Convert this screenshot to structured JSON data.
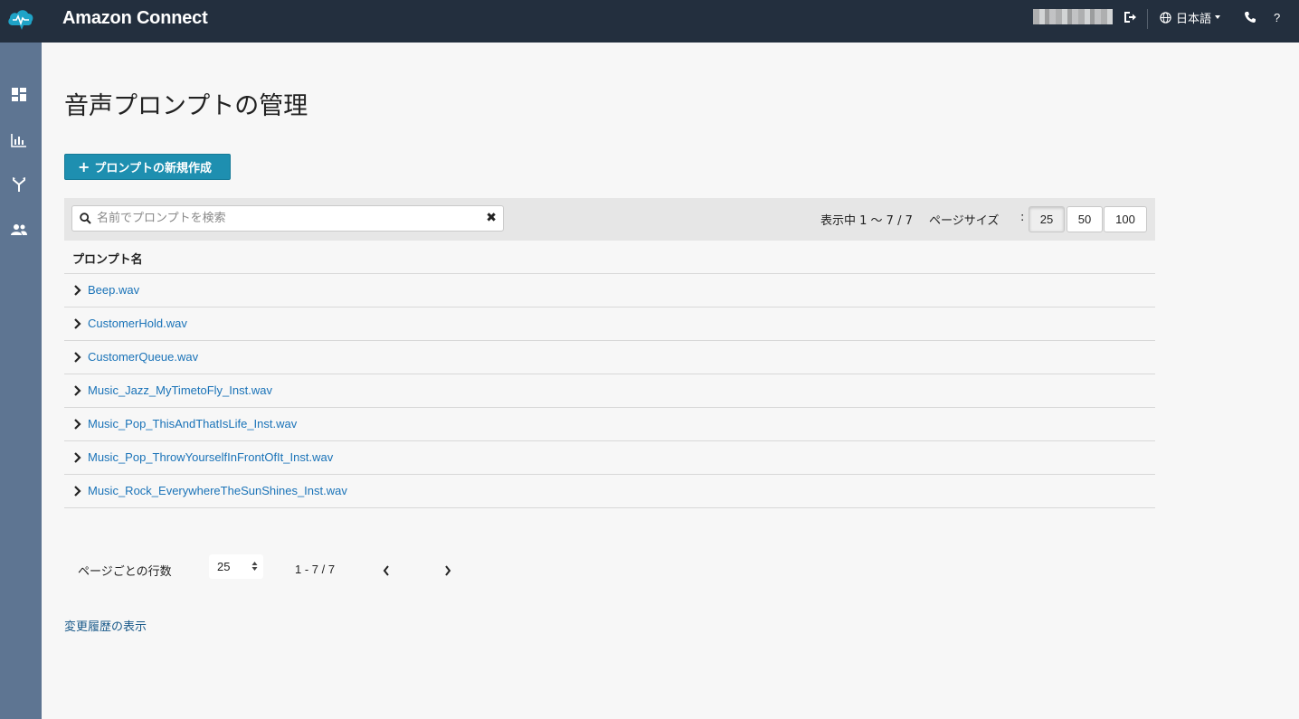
{
  "header": {
    "app_title": "Amazon Connect",
    "language": "日本語",
    "help": "?",
    "icons": [
      "cloud-logo-icon",
      "logout-icon",
      "globe-icon",
      "phone-icon",
      "help-icon"
    ]
  },
  "sidebar": {
    "items": [
      {
        "icon": "dashboard-icon"
      },
      {
        "icon": "bar-chart-icon"
      },
      {
        "icon": "routing-icon"
      },
      {
        "icon": "users-icon"
      }
    ]
  },
  "page": {
    "title": "音声プロンプトの管理",
    "create_button": "プロンプトの新規作成"
  },
  "toolbar": {
    "search_placeholder": "名前でプロンプトを検索",
    "showing": "表示中 1 〜 7 / 7",
    "page_size_label": "ページサイズ",
    "colon": ":",
    "page_sizes": [
      "25",
      "50",
      "100"
    ],
    "active_page_size": "25"
  },
  "table": {
    "column_header": "プロンプト名",
    "rows": [
      "Beep.wav",
      "CustomerHold.wav",
      "CustomerQueue.wav",
      "Music_Jazz_MyTimetoFly_Inst.wav",
      "Music_Pop_ThisAndThatIsLife_Inst.wav",
      "Music_Pop_ThrowYourselfInFrontOfIt_Inst.wav",
      "Music_Rock_EverywhereTheSunShines_Inst.wav"
    ]
  },
  "footer": {
    "rows_per_page_label": "ページごとの行数",
    "rows_per_page_value": "25",
    "range": "1 - 7 / 7",
    "history_link": "変更履歴の表示"
  },
  "colors": {
    "topbar": "#232f3e",
    "sidebar": "#5e7592",
    "primary_button": "#1e8fb0",
    "link": "#1a73b8"
  }
}
